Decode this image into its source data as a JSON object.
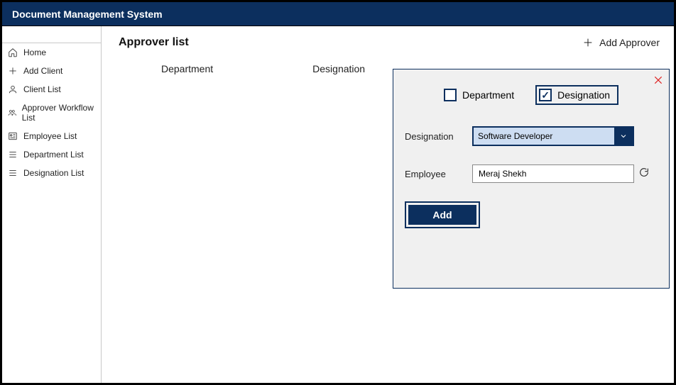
{
  "app_title": "Document Management System",
  "sidebar": {
    "items": [
      {
        "label": "Home",
        "icon": "home"
      },
      {
        "label": "Add Client",
        "icon": "plus"
      },
      {
        "label": "Client List",
        "icon": "person"
      },
      {
        "label": "Approver Workflow List",
        "icon": "people"
      },
      {
        "label": "Employee List",
        "icon": "idlist"
      },
      {
        "label": "Department List",
        "icon": "lines"
      },
      {
        "label": "Designation List",
        "icon": "lines"
      }
    ]
  },
  "page": {
    "title": "Approver list",
    "add_label": "Add Approver",
    "columns": {
      "dept": "Department",
      "desig": "Designation"
    }
  },
  "panel": {
    "dept_label": "Department",
    "desig_label": "Designation",
    "dept_checked": false,
    "desig_checked": true,
    "field_desig_label": "Designation",
    "field_desig_value": "Software Developer",
    "field_emp_label": "Employee",
    "field_emp_value": "Meraj Shekh",
    "add_btn": "Add"
  }
}
